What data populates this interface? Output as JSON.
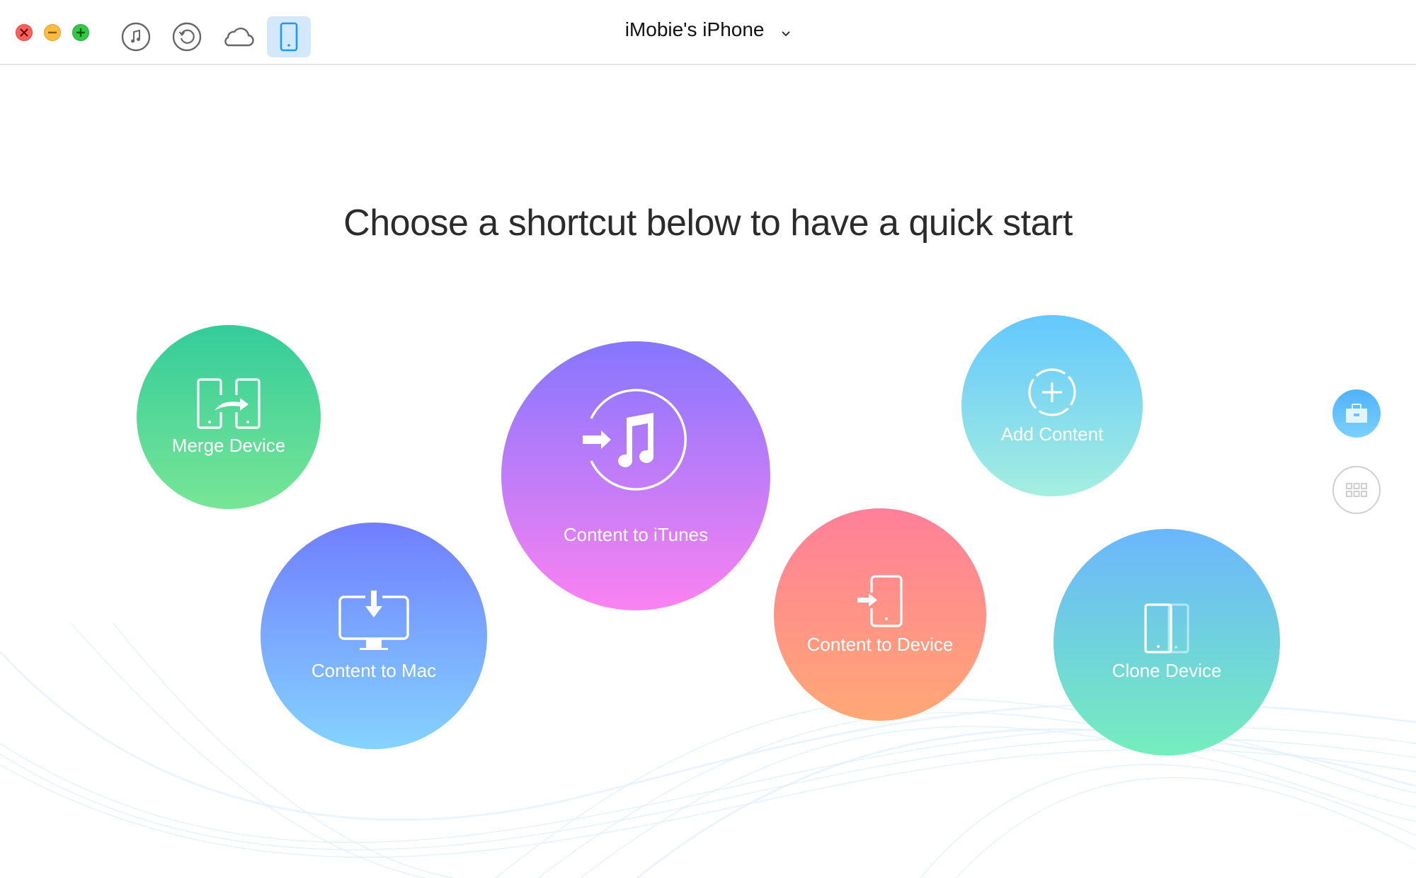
{
  "window": {
    "traffic_lights": [
      {
        "name": "close",
        "color": "#fc605c"
      },
      {
        "name": "minimize",
        "color": "#fdbc40"
      },
      {
        "name": "maximize",
        "color": "#34c84a"
      }
    ]
  },
  "toolbar": {
    "tools": [
      {
        "icon": "music-note-icon",
        "label": "iTunes Library",
        "active": false
      },
      {
        "icon": "history-icon",
        "label": "Backup",
        "active": false
      },
      {
        "icon": "cloud-icon",
        "label": "iCloud",
        "active": false
      },
      {
        "icon": "phone-icon",
        "label": "Device",
        "active": true
      }
    ],
    "device_name": "iMobie's iPhone",
    "accent": "#1a9af0",
    "active_bg": "#d3e9fb"
  },
  "main": {
    "headline": "Choose a shortcut below to have a quick start",
    "shortcuts": [
      {
        "id": "merge",
        "label": "Merge Device",
        "icon": "merge-device-icon",
        "gradient": [
          "#34cc9b",
          "#78e596"
        ]
      },
      {
        "id": "mac",
        "label": "Content to Mac",
        "icon": "monitor-download-icon",
        "gradient": [
          "#707eff",
          "#84d3ff"
        ]
      },
      {
        "id": "itunes",
        "label": "Content to iTunes",
        "icon": "itunes-import-icon",
        "gradient": [
          "#8676ff",
          "#fb82f1"
        ]
      },
      {
        "id": "device",
        "label": "Content to Device",
        "icon": "phone-import-icon",
        "gradient": [
          "#ff7f98",
          "#ffa876"
        ]
      },
      {
        "id": "add",
        "label": "Add Content",
        "icon": "add-circle-icon",
        "gradient": [
          "#63c8fe",
          "#a5eedf"
        ]
      },
      {
        "id": "clone",
        "label": "Clone Device",
        "icon": "clone-device-icon",
        "gradient": [
          "#6bb6fd",
          "#75eebd"
        ]
      }
    ]
  },
  "side_nav": [
    {
      "icon": "toolkit-briefcase-icon",
      "label": "Toolkit",
      "active": true
    },
    {
      "icon": "grid-icon",
      "label": "Categories",
      "active": false
    }
  ]
}
